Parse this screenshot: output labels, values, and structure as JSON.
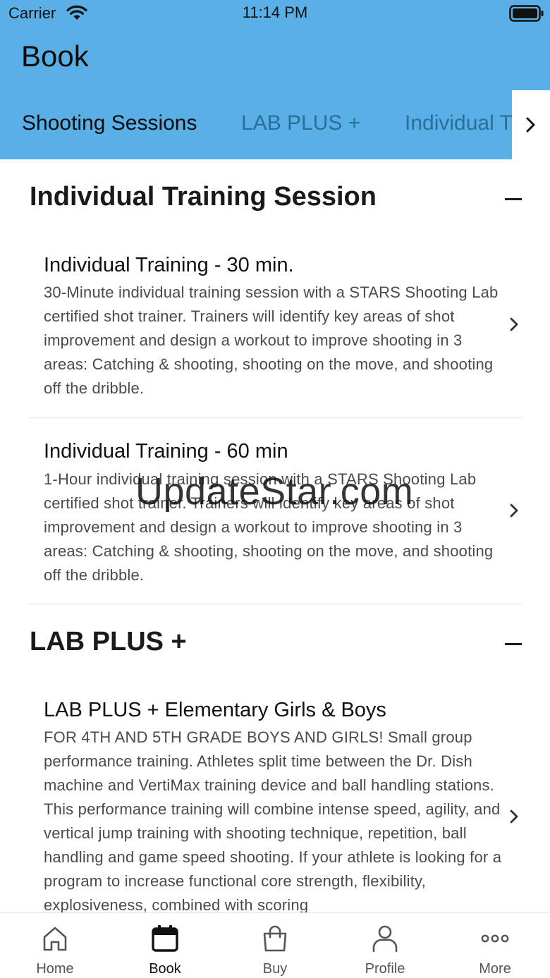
{
  "status_bar": {
    "carrier": "Carrier",
    "time": "11:14 PM"
  },
  "header": {
    "title": "Book"
  },
  "tabs": [
    {
      "label": "Shooting Sessions",
      "active": true
    },
    {
      "label": "LAB PLUS +",
      "active": false
    },
    {
      "label": "Individual Training Session",
      "active": false
    }
  ],
  "sections": [
    {
      "title": "Individual Training Session",
      "items": [
        {
          "title": "Individual Training - 30 min.",
          "description": "30-Minute individual training session with a STARS Shooting Lab certified shot trainer. Trainers will identify key areas of shot improvement and design a workout to improve shooting in 3 areas: Catching & shooting, shooting on the move, and shooting off the dribble."
        },
        {
          "title": "Individual Training - 60 min",
          "description": "1-Hour individual training session with a STARS Shooting Lab certified shot trainer. Trainers will identify key areas of shot improvement and design a workout to improve shooting in 3 areas: Catching & shooting, shooting on the move, and shooting off the dribble."
        }
      ]
    },
    {
      "title": "LAB PLUS +",
      "items": [
        {
          "title": "LAB PLUS + Elementary Girls & Boys",
          "description": "FOR 4TH AND 5TH GRADE BOYS AND GIRLS! Small group performance training. Athletes split time between the Dr. Dish machine and VertiMax training device and ball handling stations. This performance training will combine intense speed, agility, and vertical jump training with shooting technique, repetition, ball handling and game speed shooting. If your athlete is looking for a program to increase functional core strength, flexibility, explosiveness, combined with scoring"
        }
      ]
    }
  ],
  "watermark": "UpdateStar.com",
  "bottom_nav": [
    {
      "label": "Home",
      "icon": "home-icon"
    },
    {
      "label": "Book",
      "icon": "calendar-icon",
      "active": true
    },
    {
      "label": "Buy",
      "icon": "shopping-bag-icon"
    },
    {
      "label": "Profile",
      "icon": "person-icon"
    },
    {
      "label": "More",
      "icon": "more-dots-icon"
    }
  ],
  "colors": {
    "header_bg": "#5aafe6",
    "tab_inactive": "#2a6e9c"
  }
}
